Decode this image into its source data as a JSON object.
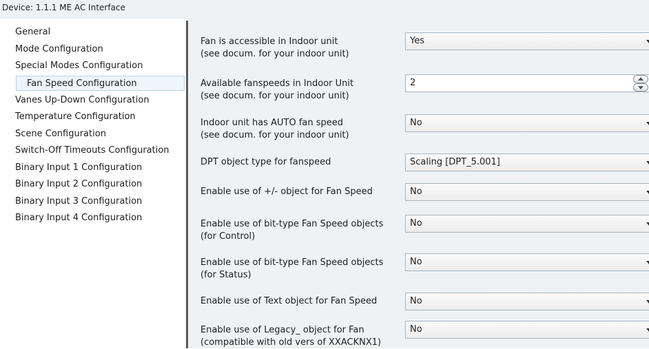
{
  "window": {
    "title": "Device: 1.1.1  ME AC Interface"
  },
  "sidebar": {
    "items": [
      {
        "label": "General"
      },
      {
        "label": "Mode Configuration"
      },
      {
        "label": "Special Modes Configuration"
      },
      {
        "label": "Fan Speed Configuration",
        "selected": true
      },
      {
        "label": "Vanes Up-Down Configuration"
      },
      {
        "label": "Temperature Configuration"
      },
      {
        "label": "Scene Configuration"
      },
      {
        "label": "Switch-Off Timeouts Configuration"
      },
      {
        "label": "Binary Input 1 Configuration"
      },
      {
        "label": "Binary Input 2 Configuration"
      },
      {
        "label": "Binary Input 3 Configuration"
      },
      {
        "label": "Binary Input 4 Configuration"
      }
    ]
  },
  "params": [
    {
      "label1": "Fan is accessible in Indoor unit",
      "label2": "(see docum. for your indoor unit)",
      "value": "Yes",
      "control": "dropdown"
    },
    {
      "label1": "Available fanspeeds in Indoor Unit",
      "label2": "(see docum. for your indoor unit)",
      "value": "2",
      "control": "spinner"
    },
    {
      "label1": "Indoor unit has AUTO fan speed",
      "label2": "(see docum. for your indoor unit)",
      "value": "No",
      "control": "dropdown"
    },
    {
      "label1": "DPT object type for fanspeed",
      "label2": "",
      "value": "Scaling [DPT_5.001]",
      "control": "dropdown"
    },
    {
      "label1": "Enable use of +/- object for Fan Speed",
      "label2": "",
      "value": "No",
      "control": "dropdown"
    },
    {
      "label1": "Enable use of bit-type Fan Speed objects",
      "label2": "(for Control)",
      "value": "No",
      "control": "dropdown"
    },
    {
      "label1": "Enable use of bit-type Fan Speed objects",
      "label2": "(for Status)",
      "value": "No",
      "control": "dropdown"
    },
    {
      "label1": "Enable use of Text object for Fan Speed",
      "label2": "",
      "value": "No",
      "control": "dropdown"
    },
    {
      "label1": "Enable use of Legacy_ object for Fan",
      "label2": "(compatible with old vers of XXACKNX1)",
      "value": "No",
      "control": "dropdown"
    }
  ],
  "colors": {
    "panel_bg": "#eef2f5",
    "selection_border": "#b6d2ea",
    "splitter": "#595959"
  }
}
